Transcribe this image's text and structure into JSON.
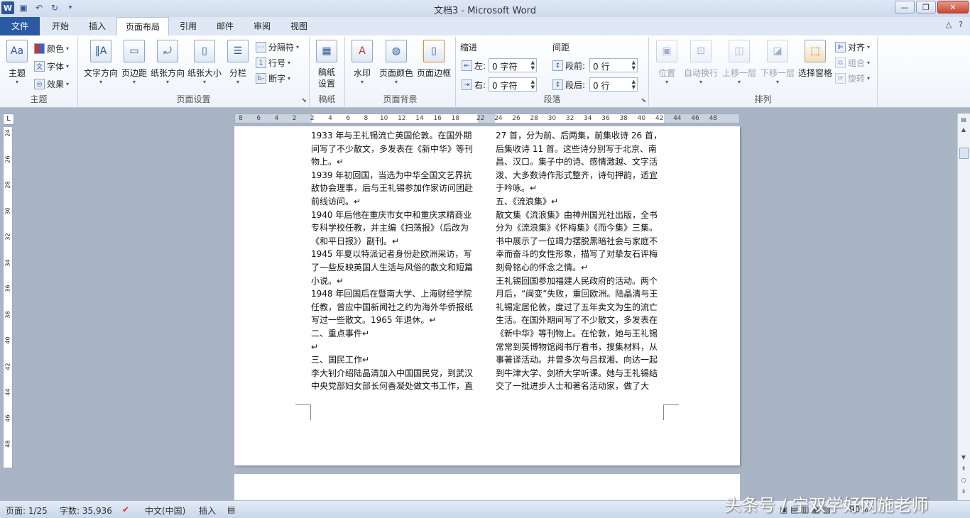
{
  "window": {
    "title": "文档3 - Microsoft Word"
  },
  "quick_access": {
    "logo": "W",
    "save_icon": "save-icon",
    "undo_icon": "undo-icon",
    "redo_icon": "redo-icon"
  },
  "tabs": [
    "文件",
    "开始",
    "插入",
    "页面布局",
    "引用",
    "邮件",
    "审阅",
    "视图"
  ],
  "active_tab": "页面布局",
  "ribbon": {
    "theme": {
      "label": "主题",
      "big": "主题",
      "colors": "颜色",
      "fonts": "字体",
      "effects": "效果"
    },
    "page_setup": {
      "label": "页面设置",
      "text_dir": "文字方向",
      "margins": "页边距",
      "orientation": "纸张方向",
      "size": "纸张大小",
      "columns": "分栏",
      "breaks": "分隔符",
      "line_numbers": "行号",
      "hyphenation": "断字"
    },
    "manuscript": {
      "label": "稿纸",
      "btn": "稿纸设置"
    },
    "page_bg": {
      "label": "页面背景",
      "watermark": "水印",
      "page_color": "页面颜色",
      "page_border": "页面边框"
    },
    "paragraph": {
      "label": "段落",
      "indent": "缩进",
      "spacing": "间距",
      "left": "左:",
      "right": "右:",
      "before": "段前:",
      "after": "段后:",
      "left_val": "0 字符",
      "right_val": "0 字符",
      "before_val": "0 行",
      "after_val": "0 行"
    },
    "arrange": {
      "label": "排列",
      "position": "位置",
      "wrap": "自动换行",
      "forward": "上移一层",
      "backward": "下移一层",
      "selection": "选择窗格",
      "align": "对齐",
      "group": "组合",
      "rotate": "旋转"
    }
  },
  "ruler": {
    "left_nums": [
      "8",
      "6",
      "4",
      "2",
      "2",
      "4",
      "6",
      "8",
      "10",
      "12",
      "14",
      "16",
      "18"
    ],
    "right_nums": [
      "22",
      "24",
      "26",
      "28",
      "30",
      "32",
      "34",
      "36",
      "38",
      "40",
      "42",
      "44",
      "46",
      "48"
    ],
    "v_nums": [
      "24",
      "26",
      "28",
      "30",
      "32",
      "34",
      "36",
      "38",
      "40",
      "42",
      "44",
      "46",
      "48"
    ]
  },
  "document": {
    "col1": [
      "1933 年与王礼锡流亡英国伦敦。在国外期间写了不少散文，多发表在《新中华》等刊物上。↵",
      "1939 年初回国，当选为中华全国文艺界抗敌协会理事，后与王礼锡参加作家访问团赴前线访问。↵",
      "1940 年后他在重庆市女中和重庆求精商业专科学校任教，并主编《扫荡报》（后改为《和平日报》）副刊。↵",
      "1945 年夏以特派记者身份赴欧洲采访，写了一些反映英国人生活与风俗的散文和短篇小说。↵",
      "1948 年回国后在暨南大学、上海财经学院任教，曾应中国新闻社之约为海外华侨报纸写过一些散文。1965 年退休。↵",
      "二、重点事件↵",
      "↵",
      "三、国民工作↵",
      "李大钊介绍陆晶清加入中国国民党，到武汉中央党部妇女部长何香凝处做文书工作，直"
    ],
    "col2": [
      "27 首，分为前、后两集，前集收诗 26 首，后集收诗 11 首。这些诗分别写于北京、南昌、汉口。集子中的诗、感情激越、文字活泼、大多数诗作形式整齐，诗句押韵，适宜于吟咏。↵",
      "五、《流浪集》↵",
      "散文集《流浪集》由神州国光社出版，全书分为《流浪集》《怀梅集》《而今集》三集。书中展示了一位竭力摆脱黑暗社会与家庭不幸而奋斗的女性形象，描写了对挚友石评梅刻骨铭心的怀念之情。↵",
      "王礼锡回国参加福建人民政府的活动。两个月后，“闽变”失败，重回欧洲。陆晶清与王礼锡定居伦敦，度过了五年卖文为生的流亡生活。在国外期间写了不少散文，多发表在《新中华》等刊物上。在伦敦，她与王礼锡常常到英博物馆阅书厅看书，搜集材料，从事著译活动。并曾多次与吕叔湘、向达一起到牛津大学、剑桥大学听课。她与王礼锡结交了一批进步人士和著名活动家，做了大"
    ]
  },
  "status": {
    "page": "页面: 1/25",
    "words": "字数: 35,936",
    "lang": "中文(中国)",
    "mode": "插入",
    "zoom": "90%"
  },
  "watermark_text": "头条号 / 宁双学好网施老师"
}
